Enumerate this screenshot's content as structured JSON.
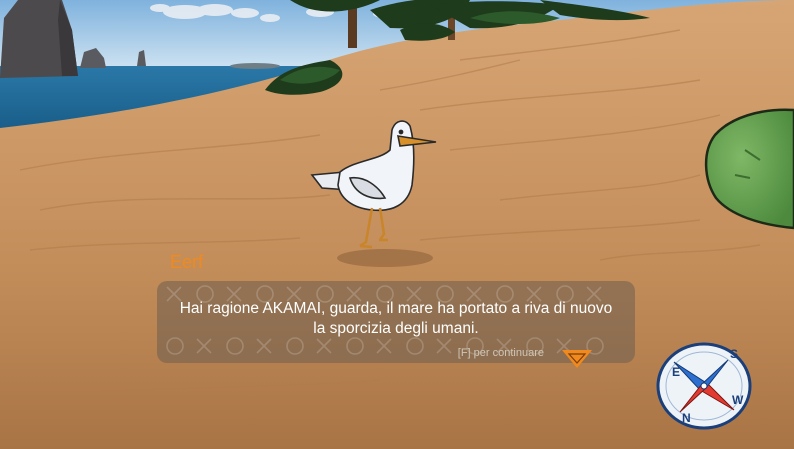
{
  "dialog": {
    "speaker": "Eerf",
    "line1": "Hai ragione AKAMAI, guarda, il mare ha portato a riva di nuovo",
    "line2": "la sporcizia degli umani.",
    "continue_hint": "[F] per continuare"
  },
  "compass": {
    "north": "N",
    "south": "S",
    "east": "E",
    "west": "W"
  },
  "colors": {
    "speaker": "#f08a1e",
    "continue_arrow": "#f08a1e",
    "sand": "#c99462",
    "sea": "#1f6d99",
    "sky": "#9ec7e6"
  }
}
